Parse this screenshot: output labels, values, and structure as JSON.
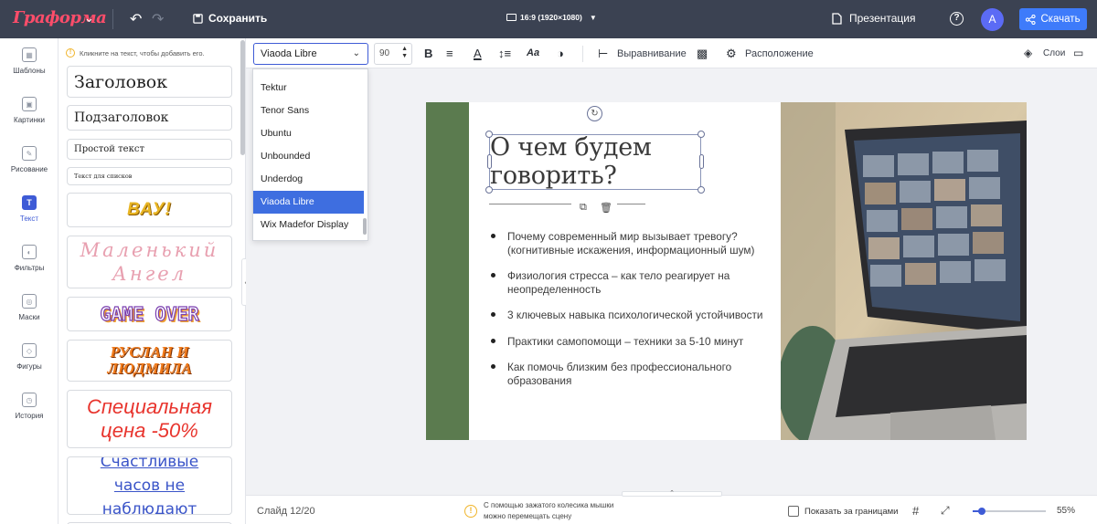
{
  "topbar": {
    "logo": "Граформа",
    "save_label": "Сохранить",
    "ratio_label": "16:9 (1920×1080)",
    "present_label": "Презентация",
    "help_glyph": "?",
    "avatar_letter": "A",
    "download_label": "Скачать"
  },
  "rail": [
    {
      "label": "Шаблоны",
      "icon": "templates-icon"
    },
    {
      "label": "Картинки",
      "icon": "image-icon"
    },
    {
      "label": "Рисование",
      "icon": "pencil-icon"
    },
    {
      "label": "Текст",
      "icon": "text-icon",
      "active": true
    },
    {
      "label": "Фильтры",
      "icon": "filter-icon"
    },
    {
      "label": "Маски",
      "icon": "mask-icon"
    },
    {
      "label": "Фигуры",
      "icon": "shapes-icon"
    },
    {
      "label": "История",
      "icon": "history-icon"
    }
  ],
  "panel": {
    "hint": "Кликните на текст, чтобы добавить его.",
    "styles": [
      "Заголовок",
      "Подзаголовок",
      "Простой текст",
      "Текст для списков",
      "ВАУ!",
      "Маленький Ангел",
      "GAME OVER",
      "Руслан и Людмила",
      "Специальная цена -50%",
      "Счастливые часов не наблюдают"
    ]
  },
  "toolbar": {
    "font": "Viaoda Libre",
    "size": "90",
    "align_label": "Выравнивание",
    "layout_label": "Расположение",
    "layers_label": "Слои"
  },
  "font_dropdown": {
    "options": [
      "Tektur",
      "Tenor Sans",
      "Ubuntu",
      "Unbounded",
      "Underdog",
      "Viaoda Libre",
      "Wix Madefor Display"
    ],
    "selected": "Viaoda Libre"
  },
  "slide": {
    "title": "О чем будем говорить?",
    "bullets": [
      "Почему современный мир вызывает тревогу? (когнитивные искажения, информационный шум)",
      "Физиология стресса – как тело реагирует на неопределенность",
      "3 ключевых навыка психологической устойчивости",
      "Практики самопомощи – техники за 5-10 минут",
      "Как помочь близким без профессионального образования"
    ],
    "accent_color": "#5b7b4f"
  },
  "status": {
    "slide_counter": "Слайд 12/20",
    "mouse_hint": "С помощью зажатого колесика мышки можно перемещать сцену",
    "bounds_label": "Показать за границами",
    "zoom": "55%",
    "zoom_fraction": 0.12
  },
  "colors": {
    "topbar": "#3b4252",
    "primary": "#3e7bfa",
    "active": "#3e5bd6",
    "logo": "#ff4d6a"
  }
}
